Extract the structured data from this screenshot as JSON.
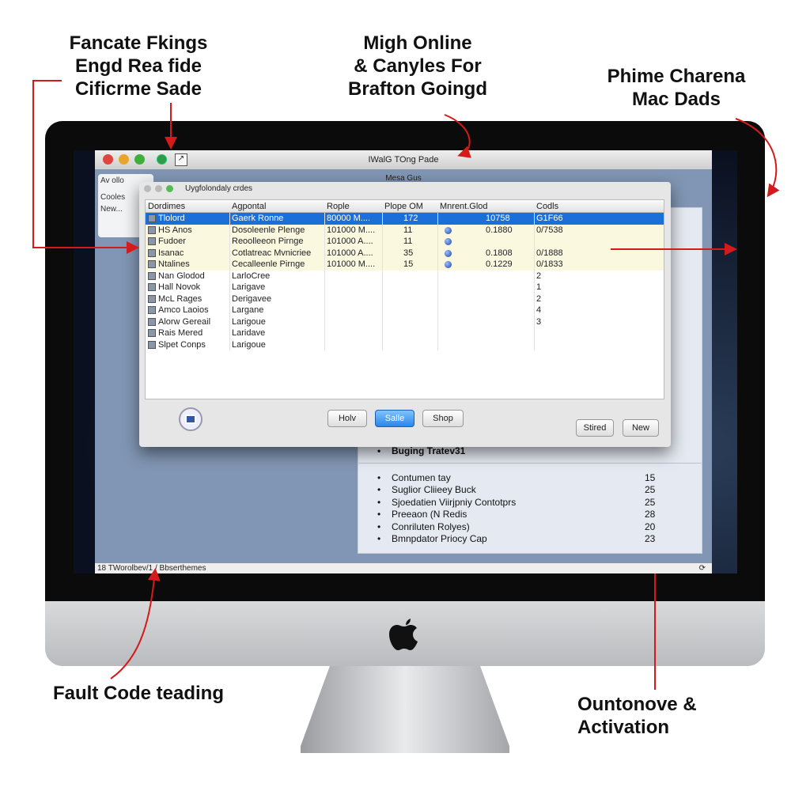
{
  "annotations": {
    "top_left": [
      "Fancate Fkings",
      "Engd Rea fide",
      "Cificrme Sade"
    ],
    "top_center": [
      "Migh Online",
      "& Canyles For",
      "Brafton Goingd"
    ],
    "top_right": [
      "Phime Charena",
      "Mac Dads"
    ],
    "bottom_left": "Fault Code teading",
    "bottom_right": [
      "Ountonove &",
      "Activation"
    ],
    "arrow_color": "#d41a1a"
  },
  "app": {
    "title": "IWalG TOng Pade",
    "subtitle": "Mesa Gus",
    "sidebar": [
      "Av ollo",
      "Cooles",
      "New..."
    ],
    "status": "18 TWorolbev/1 / Bbserthemes"
  },
  "dialog": {
    "title": "Uygfolondaly crdes",
    "columns": [
      "Dordimes",
      "Agpontal",
      "Rople",
      "Plope   OM",
      "Mnrent.Glod",
      "Codls"
    ],
    "rows": [
      {
        "name": "Tlolord",
        "a": "Gaerk Ronne",
        "r": "80000 M....",
        "p": "172",
        "dot": false,
        "m": "10758",
        "c": "G1F66",
        "style": "selected"
      },
      {
        "name": "HS Anos",
        "a": "Dosoleenle Plenge",
        "r": "101000 M....",
        "p": "11",
        "dot": true,
        "m": "0.1880",
        "c": "0/7538",
        "style": "yellow"
      },
      {
        "name": "Fudoer",
        "a": "Reoolleeon Pirnge",
        "r": "101000 A....",
        "p": "11",
        "dot": true,
        "m": "",
        "c": "",
        "style": "yellow"
      },
      {
        "name": "Isanac",
        "a": "Cotlatreac Mvnicriee",
        "r": "101000 A....",
        "p": "35",
        "dot": true,
        "m": "0.1808",
        "c": "0/1888",
        "style": "yellow"
      },
      {
        "name": "Ntalines",
        "a": "Cecalleenle Pirnge",
        "r": "101000 M....",
        "p": "15",
        "dot": true,
        "m": "0.1229",
        "c": "0/1833",
        "style": "yellow"
      },
      {
        "name": "Nan Glodod",
        "a": "LarloCree",
        "r": "",
        "p": "",
        "dot": false,
        "m": "",
        "c": "2",
        "style": "plain"
      },
      {
        "name": "Hall Novok",
        "a": "Larigave",
        "r": "",
        "p": "",
        "dot": false,
        "m": "",
        "c": "1",
        "style": "plain"
      },
      {
        "name": "McL Rages",
        "a": "Derigavee",
        "r": "",
        "p": "",
        "dot": false,
        "m": "",
        "c": "2",
        "style": "plain"
      },
      {
        "name": "Amco Laoios",
        "a": "Largane",
        "r": "",
        "p": "",
        "dot": false,
        "m": "",
        "c": "4",
        "style": "plain"
      },
      {
        "name": "Alorw Gereail",
        "a": "Larigoue",
        "r": "",
        "p": "",
        "dot": false,
        "m": "",
        "c": "3",
        "style": "plain"
      },
      {
        "name": "Rais Mered",
        "a": "Laridave",
        "r": "",
        "p": "",
        "dot": false,
        "m": "",
        "c": "",
        "style": "plain"
      },
      {
        "name": "Slpet Conps",
        "a": "Larigoue",
        "r": "",
        "p": "",
        "dot": false,
        "m": "",
        "c": "",
        "style": "plain"
      }
    ],
    "buttons": {
      "holv": "Holv",
      "save": "Salle",
      "shop": "Shop",
      "stired": "Stired",
      "new": "New"
    }
  },
  "panel": {
    "heading": "Buging Tratev31",
    "items": [
      {
        "label": "Contumen tay",
        "value": "15"
      },
      {
        "label": "Suglior Cliieey Buck",
        "value": "25"
      },
      {
        "label": "Sjoedatien Viirjpniy Contotprs",
        "value": "25"
      },
      {
        "label": "Preeaon (N Redis",
        "value": "28"
      },
      {
        "label": "Conriluten Rolyes)",
        "value": "20"
      },
      {
        "label": "Bmnpdator Priocy Cap",
        "value": "23"
      }
    ]
  },
  "colors": {
    "selection": "#1a6fd8",
    "row_highlight": "#fbf8e0",
    "desktop": "#8196b4"
  }
}
